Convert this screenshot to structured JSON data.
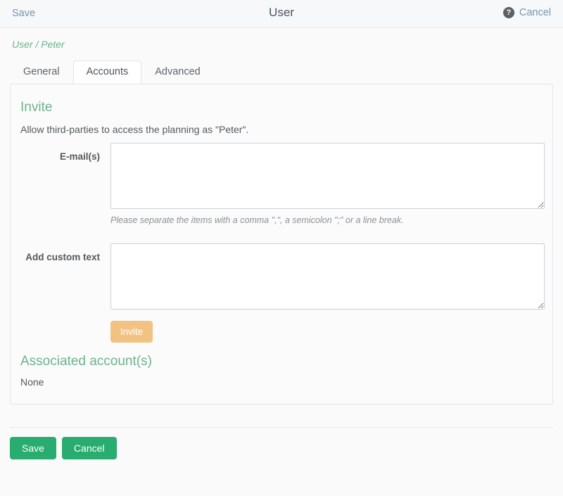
{
  "topbar": {
    "save_label": "Save",
    "title": "User",
    "help_icon": "help-circle-icon",
    "help_glyph": "?",
    "cancel_label": "Cancel"
  },
  "breadcrumb": "User / Peter",
  "tabs": [
    {
      "label": "General",
      "active": false
    },
    {
      "label": "Accounts",
      "active": true
    },
    {
      "label": "Advanced",
      "active": false
    }
  ],
  "invite": {
    "heading": "Invite",
    "description": "Allow third-parties to access the planning as \"Peter\".",
    "emails_label": "E-mail(s)",
    "emails_value": "",
    "emails_placeholder": "",
    "emails_hint": "Please separate the items with a comma \",\", a semicolon \";\" or a line break.",
    "custom_text_label": "Add custom text",
    "custom_text_value": "",
    "custom_text_placeholder": "",
    "invite_button_label": "Invite"
  },
  "associated": {
    "heading": "Associated account(s)",
    "value": "None"
  },
  "footer": {
    "save_label": "Save",
    "cancel_label": "Cancel"
  },
  "colors": {
    "accent_green": "#6cb48c",
    "button_green": "#29ac6f",
    "invite_orange": "#f3c283",
    "link_blue": "#7a93ab",
    "page_background": "#fafafa"
  }
}
